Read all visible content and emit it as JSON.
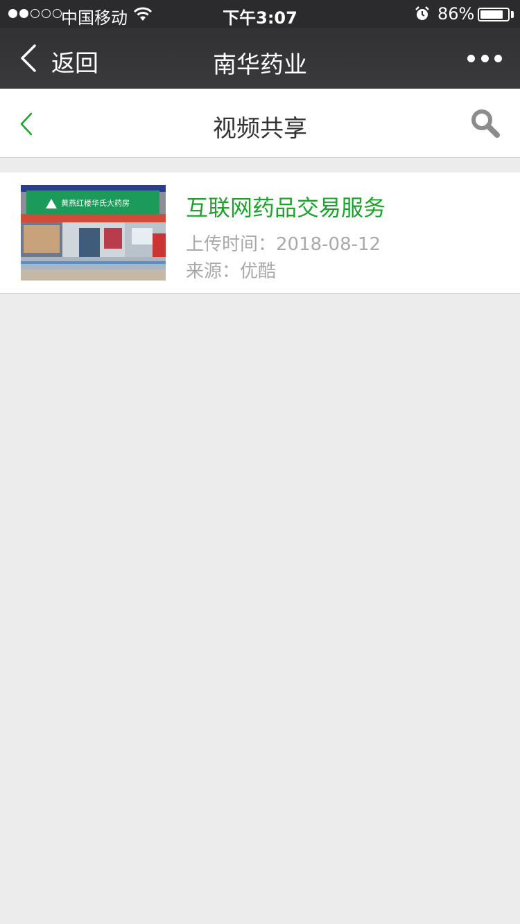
{
  "status_bar": {
    "carrier": "中国移动",
    "time": "下午3:07",
    "battery_percent": "86%",
    "battery_level": 0.86,
    "signal_bars": 2
  },
  "navbar": {
    "back_label": "返回",
    "title": "南华药业",
    "more_icon": "more-dots-icon"
  },
  "page_header": {
    "title": "视频共享",
    "back_icon": "chevron-left-icon",
    "search_icon": "search-icon"
  },
  "videos": [
    {
      "title": "互联网药品交易服务",
      "upload_label": "上传时间：",
      "upload_date": "2018-08-12",
      "upload_text": "上传时间：2018-08-12",
      "source_text": "来源：优酷",
      "thumbnail_sign_text": "黄燕红楼华氏大药房"
    }
  ],
  "colors": {
    "accent_green": "#1ba32a",
    "nav_bg": "#333335",
    "page_bg": "#ececec",
    "meta_gray": "#a9a9a9"
  }
}
